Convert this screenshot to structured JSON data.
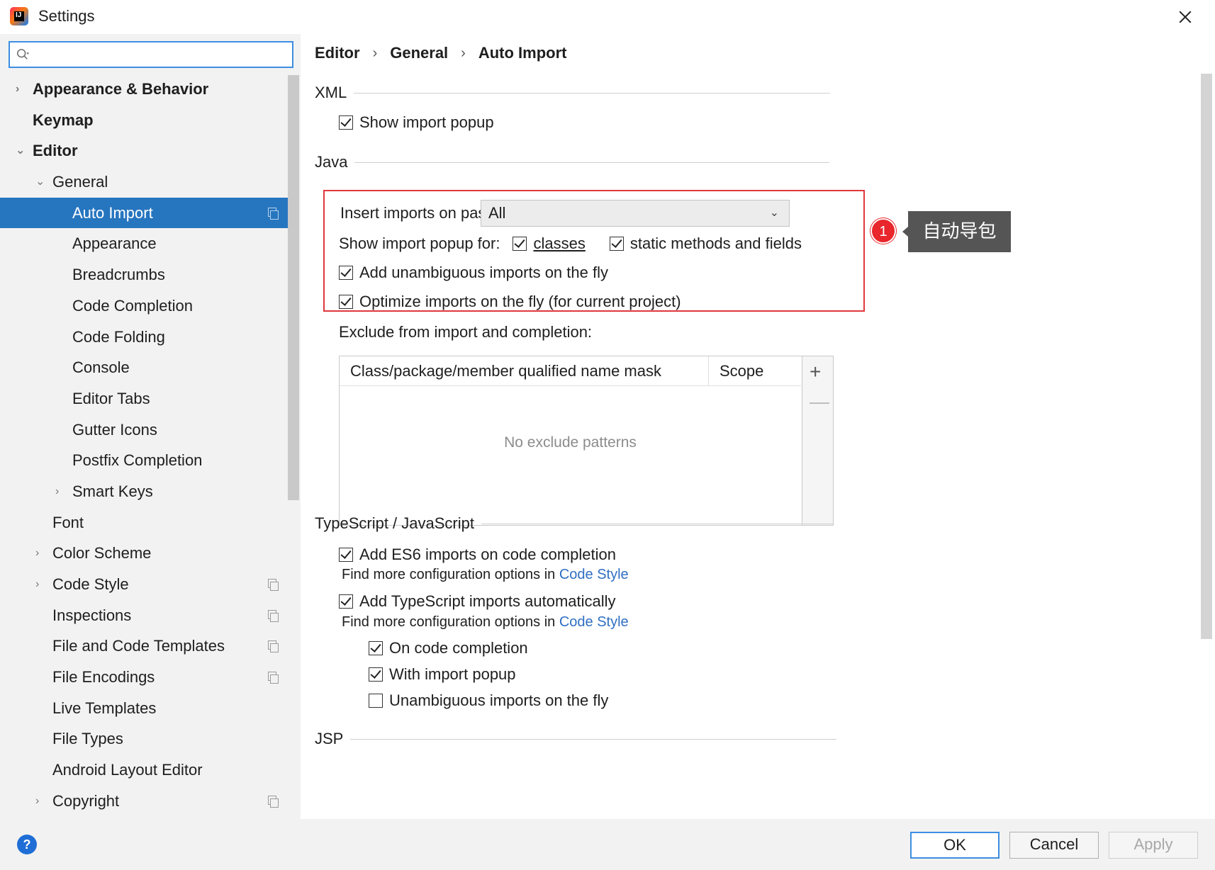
{
  "window": {
    "title": "Settings"
  },
  "search": {
    "placeholder": ""
  },
  "sidebar": {
    "items": [
      {
        "label": "Appearance & Behavior",
        "level": 0,
        "arrow": "›",
        "bold": true
      },
      {
        "label": "Keymap",
        "level": 0,
        "arrow": "",
        "bold": true
      },
      {
        "label": "Editor",
        "level": 0,
        "arrow": "⌄",
        "bold": true
      },
      {
        "label": "General",
        "level": 1,
        "arrow": "⌄"
      },
      {
        "label": "Auto Import",
        "level": 2,
        "arrow": "",
        "selected": true,
        "copy": true
      },
      {
        "label": "Appearance",
        "level": 2,
        "arrow": ""
      },
      {
        "label": "Breadcrumbs",
        "level": 2,
        "arrow": ""
      },
      {
        "label": "Code Completion",
        "level": 2,
        "arrow": ""
      },
      {
        "label": "Code Folding",
        "level": 2,
        "arrow": ""
      },
      {
        "label": "Console",
        "level": 2,
        "arrow": ""
      },
      {
        "label": "Editor Tabs",
        "level": 2,
        "arrow": ""
      },
      {
        "label": "Gutter Icons",
        "level": 2,
        "arrow": ""
      },
      {
        "label": "Postfix Completion",
        "level": 2,
        "arrow": ""
      },
      {
        "label": "Smart Keys",
        "level": 2,
        "arrow": "›"
      },
      {
        "label": "Font",
        "level": 1,
        "arrow": ""
      },
      {
        "label": "Color Scheme",
        "level": 1,
        "arrow": "›"
      },
      {
        "label": "Code Style",
        "level": 1,
        "arrow": "›",
        "copy": true
      },
      {
        "label": "Inspections",
        "level": 1,
        "arrow": "",
        "copy": true
      },
      {
        "label": "File and Code Templates",
        "level": 1,
        "arrow": "",
        "copy": true
      },
      {
        "label": "File Encodings",
        "level": 1,
        "arrow": "",
        "copy": true
      },
      {
        "label": "Live Templates",
        "level": 1,
        "arrow": ""
      },
      {
        "label": "File Types",
        "level": 1,
        "arrow": ""
      },
      {
        "label": "Android Layout Editor",
        "level": 1,
        "arrow": ""
      },
      {
        "label": "Copyright",
        "level": 1,
        "arrow": "›",
        "copy": true
      }
    ]
  },
  "breadcrumb": {
    "editor": "Editor",
    "sep": "›",
    "general": "General",
    "page": "Auto Import"
  },
  "xml": {
    "title": "XML",
    "show_import_popup": "Show import popup"
  },
  "java": {
    "title": "Java",
    "insert_imports_label": "Insert imports on paste:",
    "insert_imports_value": "All",
    "show_popup_for": "Show import popup for:",
    "classes": "classes",
    "static_methods": "static methods and fields",
    "add_unambiguous": "Add unambiguous imports on the fly",
    "optimize_imports": "Optimize imports on the fly (for current project)",
    "exclude_label": "Exclude from import and completion:",
    "table_col1": "Class/package/member qualified name mask",
    "table_col2": "Scope",
    "table_empty": "No exclude patterns",
    "add_symbol": "+",
    "remove_symbol": "—"
  },
  "annotation": {
    "number": "1",
    "text": "自动导包"
  },
  "ts": {
    "title": "TypeScript / JavaScript",
    "add_es6": "Add ES6 imports on code completion",
    "find_more_1": "Find more configuration options in ",
    "code_style_1": "Code Style",
    "add_ts": "Add TypeScript imports automatically",
    "find_more_2": "Find more configuration options in ",
    "code_style_2": "Code Style",
    "on_completion": "On code completion",
    "with_popup": "With import popup",
    "unambiguous": "Unambiguous imports on the fly"
  },
  "jsp": {
    "title": "JSP"
  },
  "footer": {
    "help": "?",
    "ok": "OK",
    "cancel": "Cancel",
    "apply": "Apply"
  },
  "colors": {
    "selection": "#2675bf",
    "highlight_box": "#e0383c",
    "link": "#2f6fc4"
  }
}
